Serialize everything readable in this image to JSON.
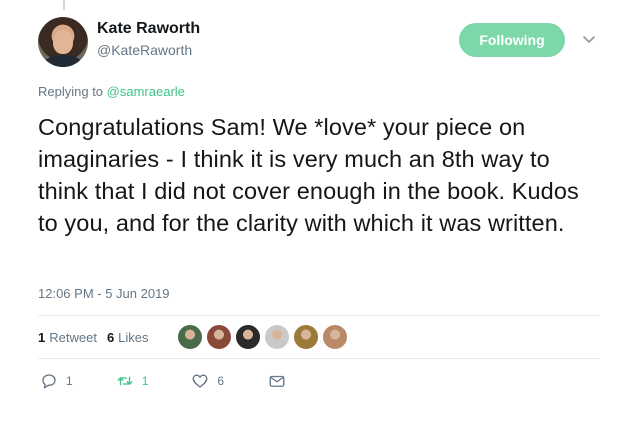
{
  "author": {
    "name": "Kate Raworth",
    "handle": "@KateRaworth"
  },
  "follow_button": {
    "label": "Following",
    "color": "#7dd8a9"
  },
  "reply": {
    "prefix": "Replying to",
    "to": "@samraearle"
  },
  "tweet": {
    "text": "Congratulations Sam! We *love* your piece on imaginaries - I think it is very much an 8th way to think that I did not cover enough in the book. Kudos to you, and for the clarity with which it was written.",
    "timestamp": "12:06 PM - 5 Jun 2019"
  },
  "stats": {
    "retweet_count": "1",
    "retweet_label": "Retweet",
    "like_count": "6",
    "like_label": "Likes"
  },
  "likers": [
    {
      "icon": "liker-avatar-1",
      "color": "#4a6b4a"
    },
    {
      "icon": "liker-avatar-2",
      "color": "#8a4a3a"
    },
    {
      "icon": "liker-avatar-3",
      "color": "#2a2a2a"
    },
    {
      "icon": "liker-avatar-4",
      "color": "#c9c9c9"
    },
    {
      "icon": "liker-avatar-5",
      "color": "#9c7a3a"
    },
    {
      "icon": "liker-avatar-6",
      "color": "#b88a6a"
    }
  ],
  "actions": {
    "reply_count": "1",
    "retweet_count": "1",
    "like_count": "6"
  },
  "colors": {
    "accent_green": "#3fc28b",
    "muted": "#657786"
  }
}
